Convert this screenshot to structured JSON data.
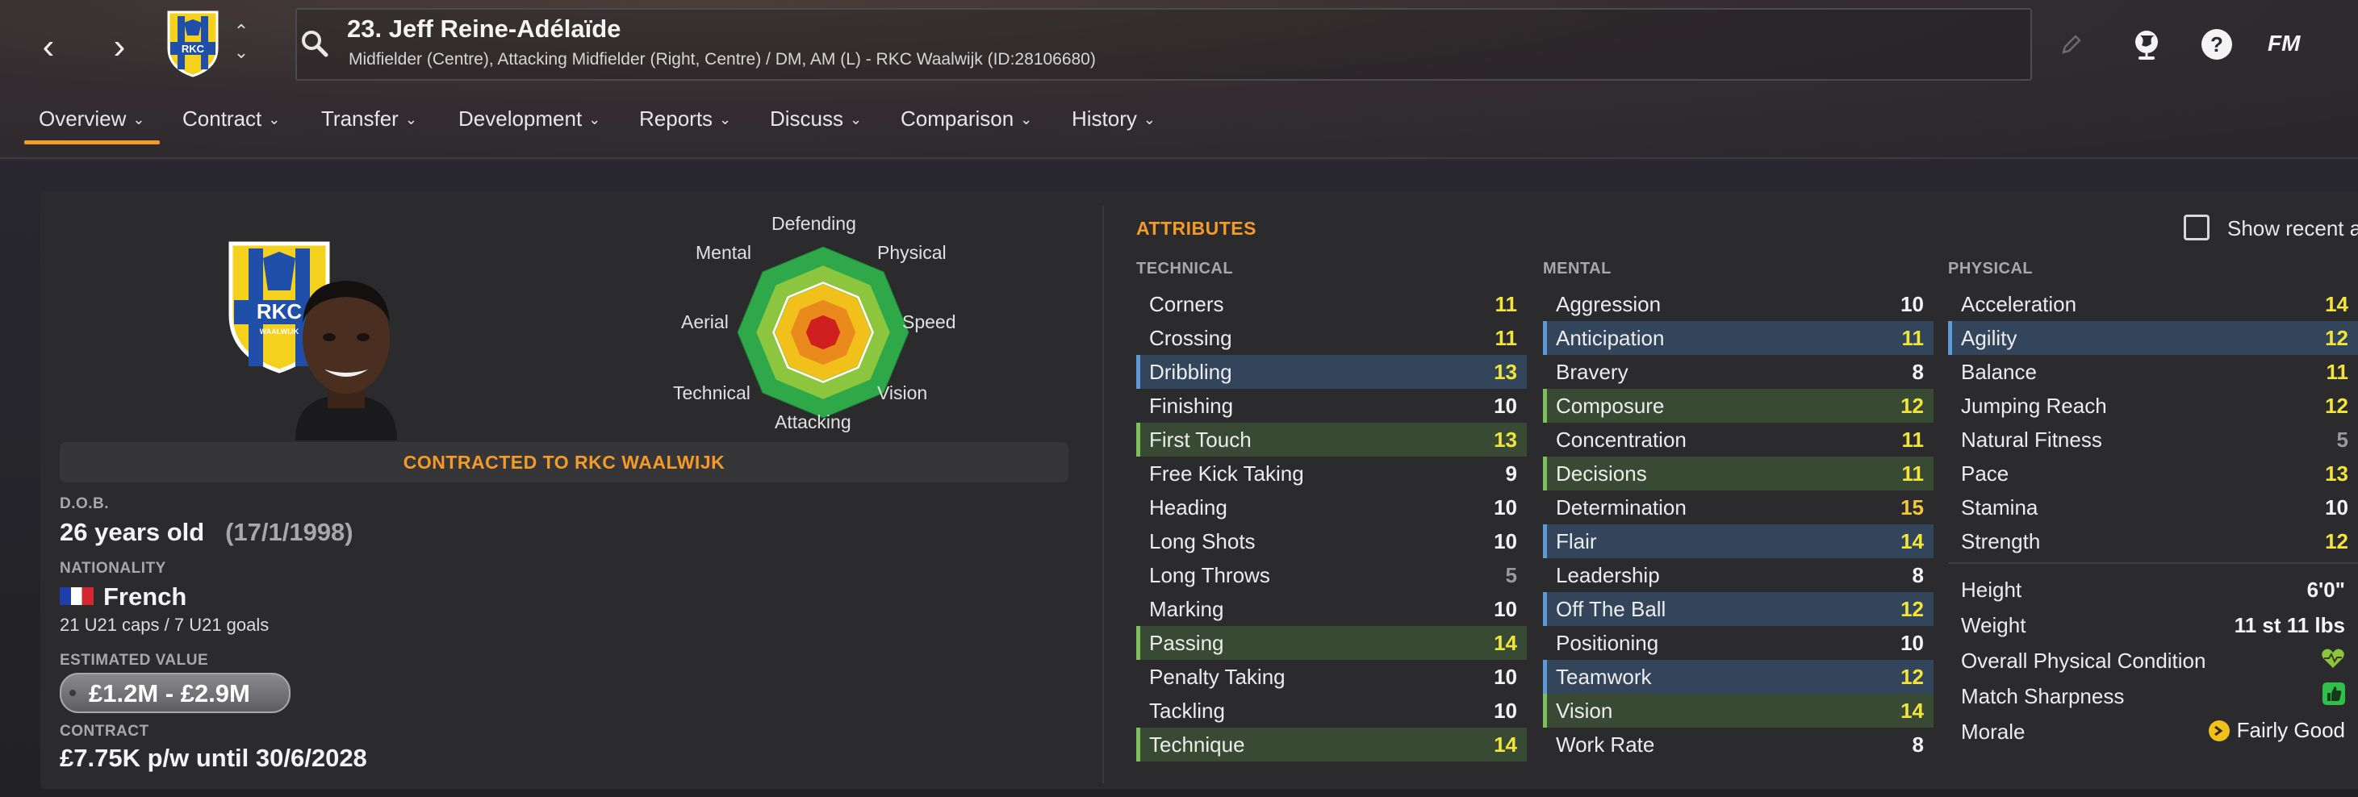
{
  "header": {
    "player_name": "23. Jeff Reine-Adélaïde",
    "player_subtitle": "Midfielder (Centre), Attacking Midfielder (Right, Centre) / DM, AM (L) - RKC Waalwijk (ID:28106680)",
    "club_crest_text": "RKC",
    "club_crest_subtext": "WAALWIJK",
    "fm_logo": "FM",
    "icons": [
      "back-arrow-icon",
      "forward-arrow-icon",
      "search-icon",
      "edit-pencil-icon",
      "globe-icon",
      "help-icon",
      "fm-logo-icon"
    ]
  },
  "tabs": [
    {
      "label": "Overview"
    },
    {
      "label": "Contract"
    },
    {
      "label": "Transfer"
    },
    {
      "label": "Development"
    },
    {
      "label": "Reports"
    },
    {
      "label": "Discuss"
    },
    {
      "label": "Comparison"
    },
    {
      "label": "History"
    }
  ],
  "overview": {
    "contract_banner": "CONTRACTED TO RKC WAALWIJK",
    "dob_label": "D.O.B.",
    "age": "26 years old",
    "dob": "(17/1/1998)",
    "nationality_label": "NATIONALITY",
    "nationality": "French",
    "caps": "21 U21 caps / 7 U21 goals",
    "value_label": "ESTIMATED VALUE",
    "value": "£1.2M - £2.9M",
    "contract_label": "CONTRACT",
    "contract": "£7.75K p/w until 30/6/2028"
  },
  "radar": {
    "labels": {
      "defending": "Defending",
      "physical": "Physical",
      "speed": "Speed",
      "vision": "Vision",
      "attacking": "Attacking",
      "technical": "Technical",
      "aerial": "Aerial",
      "mental": "Mental"
    },
    "colors": [
      "#2fa84a",
      "#8cc63f",
      "#f2c01a",
      "#ea8a1c",
      "#d01f1f"
    ]
  },
  "attributes": {
    "title": "ATTRIBUTES",
    "show_recent_label": "Show recent a",
    "technical_head": "TECHNICAL",
    "mental_head": "MENTAL",
    "physical_head": "PHYSICAL",
    "technical": [
      {
        "name": "Corners",
        "value": "11",
        "hl": ""
      },
      {
        "name": "Crossing",
        "value": "11",
        "hl": ""
      },
      {
        "name": "Dribbling",
        "value": "13",
        "hl": "blue"
      },
      {
        "name": "Finishing",
        "value": "10",
        "hl": ""
      },
      {
        "name": "First Touch",
        "value": "13",
        "hl": "green"
      },
      {
        "name": "Free Kick Taking",
        "value": "9",
        "hl": ""
      },
      {
        "name": "Heading",
        "value": "10",
        "hl": ""
      },
      {
        "name": "Long Shots",
        "value": "10",
        "hl": ""
      },
      {
        "name": "Long Throws",
        "value": "5",
        "hl": ""
      },
      {
        "name": "Marking",
        "value": "10",
        "hl": ""
      },
      {
        "name": "Passing",
        "value": "14",
        "hl": "green"
      },
      {
        "name": "Penalty Taking",
        "value": "10",
        "hl": ""
      },
      {
        "name": "Tackling",
        "value": "10",
        "hl": ""
      },
      {
        "name": "Technique",
        "value": "14",
        "hl": "green"
      }
    ],
    "mental": [
      {
        "name": "Aggression",
        "value": "10",
        "hl": ""
      },
      {
        "name": "Anticipation",
        "value": "11",
        "hl": "blue"
      },
      {
        "name": "Bravery",
        "value": "8",
        "hl": ""
      },
      {
        "name": "Composure",
        "value": "12",
        "hl": "green"
      },
      {
        "name": "Concentration",
        "value": "11",
        "hl": ""
      },
      {
        "name": "Decisions",
        "value": "11",
        "hl": "green"
      },
      {
        "name": "Determination",
        "value": "15",
        "hl": ""
      },
      {
        "name": "Flair",
        "value": "14",
        "hl": "blue"
      },
      {
        "name": "Leadership",
        "value": "8",
        "hl": ""
      },
      {
        "name": "Off The Ball",
        "value": "12",
        "hl": "blue"
      },
      {
        "name": "Positioning",
        "value": "10",
        "hl": ""
      },
      {
        "name": "Teamwork",
        "value": "12",
        "hl": "blue"
      },
      {
        "name": "Vision",
        "value": "14",
        "hl": "green"
      },
      {
        "name": "Work Rate",
        "value": "8",
        "hl": ""
      }
    ],
    "physical": [
      {
        "name": "Acceleration",
        "value": "14",
        "hl": ""
      },
      {
        "name": "Agility",
        "value": "12",
        "hl": "blue"
      },
      {
        "name": "Balance",
        "value": "11",
        "hl": ""
      },
      {
        "name": "Jumping Reach",
        "value": "12",
        "hl": ""
      },
      {
        "name": "Natural Fitness",
        "value": "5",
        "hl": ""
      },
      {
        "name": "Pace",
        "value": "13",
        "hl": ""
      },
      {
        "name": "Stamina",
        "value": "10",
        "hl": ""
      },
      {
        "name": "Strength",
        "value": "12",
        "hl": ""
      }
    ],
    "physical_info": [
      {
        "name": "Height",
        "value": "6'0\""
      },
      {
        "name": "Weight",
        "value": "11 st 11 lbs"
      },
      {
        "name": "Overall Physical Condition",
        "value": "",
        "icon": "heart-icon"
      },
      {
        "name": "Match Sharpness",
        "value": "",
        "icon": "thumbs-up-icon"
      },
      {
        "name": "Morale",
        "value": "Fairly Good",
        "icon": "morale-icon"
      }
    ]
  }
}
